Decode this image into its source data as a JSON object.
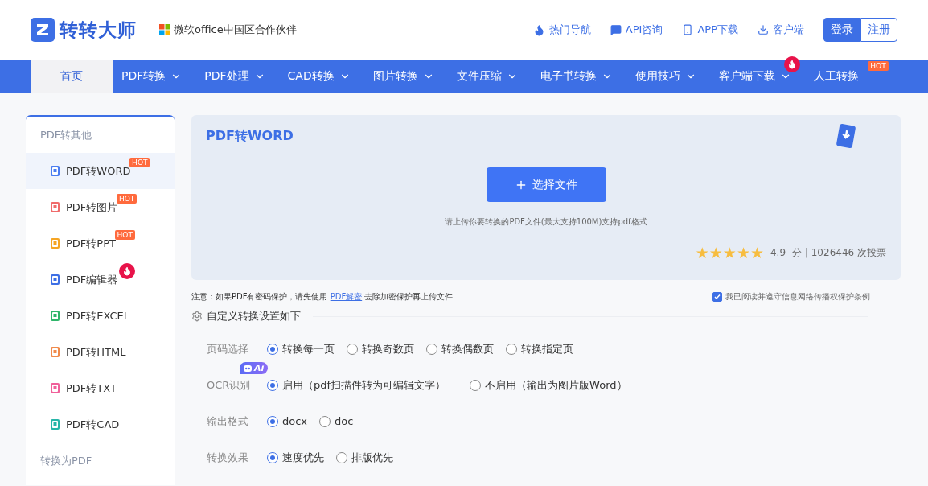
{
  "header": {
    "logo_text": "转转大师",
    "partner": "微软office中国区合作伙伴",
    "links": [
      {
        "kind": "fire",
        "label": "热门导航"
      },
      {
        "kind": "chat",
        "label": "API咨询"
      },
      {
        "kind": "phone",
        "label": "APP下载"
      },
      {
        "kind": "download",
        "label": "客户端"
      }
    ],
    "login": "登录",
    "register": "注册"
  },
  "nav": [
    {
      "label": "首页",
      "selected": true,
      "dropdown": false,
      "flame": false
    },
    {
      "label": "PDF转换",
      "selected": false,
      "dropdown": true,
      "flame": false
    },
    {
      "label": "PDF处理",
      "selected": false,
      "dropdown": true,
      "flame": false
    },
    {
      "label": "CAD转换",
      "selected": false,
      "dropdown": true,
      "flame": false
    },
    {
      "label": "图片转换",
      "selected": false,
      "dropdown": true,
      "flame": false
    },
    {
      "label": "文件压缩",
      "selected": false,
      "dropdown": true,
      "flame": false
    },
    {
      "label": "电子书转换",
      "selected": false,
      "dropdown": true,
      "flame": false
    },
    {
      "label": "使用技巧",
      "selected": false,
      "dropdown": true,
      "flame": false
    },
    {
      "label": "客户端下载",
      "selected": false,
      "dropdown": true,
      "flame": true
    },
    {
      "label": "人工转换",
      "selected": false,
      "dropdown": false,
      "flame": false,
      "badge": "HOT"
    }
  ],
  "sidebar": [
    {
      "title": "PDF转其他",
      "items": [
        {
          "label": "PDF转WORD",
          "selected": true,
          "color": "#4a7cf0",
          "flame": false,
          "badge": "HOT"
        },
        {
          "label": "PDF转图片",
          "selected": false,
          "color": "#f06b6b",
          "flame": false,
          "badge": "HOT"
        },
        {
          "label": "PDF转PPT",
          "selected": false,
          "color": "#f5a524",
          "flame": false,
          "badge": "HOT"
        },
        {
          "label": "PDF编辑器",
          "selected": false,
          "color": "#3d6fe5",
          "flame": true
        },
        {
          "label": "PDF转EXCEL",
          "selected": false,
          "color": "#2fb56a",
          "flame": false
        },
        {
          "label": "PDF转HTML",
          "selected": false,
          "color": "#f08a4b",
          "flame": false
        },
        {
          "label": "PDF转TXT",
          "selected": false,
          "color": "#f0609a",
          "flame": false
        },
        {
          "label": "PDF转CAD",
          "selected": false,
          "color": "#26b5a8",
          "flame": false
        }
      ]
    },
    {
      "title": "转换为PDF"
    }
  ],
  "upload": {
    "title": "PDF转WORD",
    "button": "选择文件",
    "hint": "请上传你要转换的PDF文件(最大支持100M)支持pdf格式",
    "stars": 5,
    "score": "4.9",
    "votes": "分 | 1026446 次投票"
  },
  "notice": {
    "before": "注意：如果PDF有密码保护，请先使用",
    "link": "PDF解密",
    "after": "去除加密保护再上传文件"
  },
  "agreement": {
    "checked": true,
    "label": "我已阅读并遵守信息网络传播权保护条例"
  },
  "settings": {
    "title": "自定义转换设置如下",
    "rows": [
      {
        "label": "页码选择",
        "options": [
          {
            "label": "转换每一页",
            "selected": true
          },
          {
            "label": "转换奇数页",
            "selected": false
          },
          {
            "label": "转换偶数页",
            "selected": false
          },
          {
            "label": "转换指定页",
            "selected": false
          }
        ]
      },
      {
        "label": "OCR识别",
        "badge": "Ai",
        "options": [
          {
            "label": "启用（pdf扫描件转为可编辑文字）",
            "selected": true
          },
          {
            "label": "不启用（输出为图片版Word）",
            "selected": false
          }
        ]
      },
      {
        "label": "输出格式",
        "options": [
          {
            "label": "docx",
            "selected": true
          },
          {
            "label": "doc",
            "selected": false
          }
        ]
      },
      {
        "label": "转换效果",
        "options": [
          {
            "label": "速度优先",
            "selected": true
          },
          {
            "label": "排版优先",
            "selected": false
          }
        ]
      }
    ]
  }
}
